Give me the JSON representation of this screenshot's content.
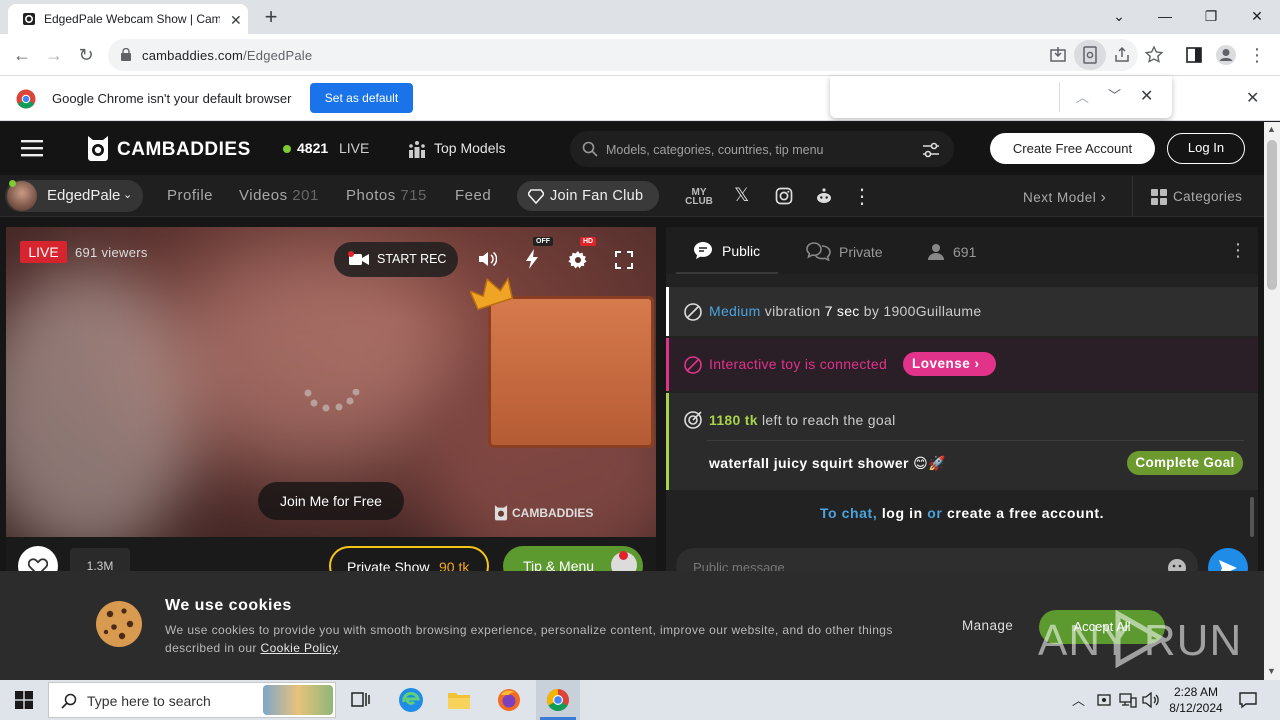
{
  "browser": {
    "tab_title": "EdgedPale Webcam Show | Cam",
    "url_host": "cambaddies.com",
    "url_path": "/EdgedPale",
    "infobar_message": "Google Chrome isn't your default browser",
    "infobar_button": "Set as default"
  },
  "site": {
    "logo_text": "CAMBADDIES",
    "live_count": "4821",
    "live_label": "LIVE",
    "top_models": "Top Models",
    "search_placeholder": "Models, categories, countries, tip menu",
    "create_account": "Create Free Account",
    "login": "Log In"
  },
  "subnav": {
    "model_name": "EdgedPale",
    "profile": "Profile",
    "videos": "Videos",
    "videos_count": "201",
    "photos": "Photos",
    "photos_count": "715",
    "feed": "Feed",
    "fan_club": "Join Fan Club",
    "next_model": "Next Model",
    "categories": "Categories"
  },
  "video": {
    "live_badge": "LIVE",
    "viewers": "691 viewers",
    "start_rec": "START REC",
    "off_badge": "OFF",
    "hd_badge": "HD",
    "join_free": "Join Me for Free",
    "watermark": "CAMBADDIES",
    "likes": "1.3M",
    "private_show": "Private Show",
    "private_price": "90 tk",
    "tip_menu": "Tip & Menu"
  },
  "chat": {
    "tab_public": "Public",
    "tab_private": "Private",
    "user_count": "691",
    "msg1_level": "Medium",
    "msg1_text": "vibration",
    "msg1_duration": "7 sec",
    "msg1_by": "by 1900Guillaume",
    "msg2_text": "Interactive toy is connected",
    "msg2_badge": "Lovense",
    "msg3_amount": "1180 tk",
    "msg3_text": "left to reach the goal",
    "goal_text": "waterfall juicy squirt shower 😊🚀",
    "goal_button": "Complete Goal",
    "prompt_to_chat": "To chat,",
    "prompt_login": "log in",
    "prompt_or": "or",
    "prompt_create": "create a free account.",
    "input_placeholder": "Public message"
  },
  "cookie": {
    "title": "We use cookies",
    "body": "We use cookies to provide you with smooth browsing experience, personalize content, improve our website, and do other things described in our",
    "link": "Cookie Policy",
    "manage": "Manage",
    "accept": "Accept All"
  },
  "watermark": {
    "text": "ANY RUN"
  },
  "taskbar": {
    "search_placeholder": "Type here to search",
    "time": "2:28 AM",
    "date": "8/12/2024"
  }
}
